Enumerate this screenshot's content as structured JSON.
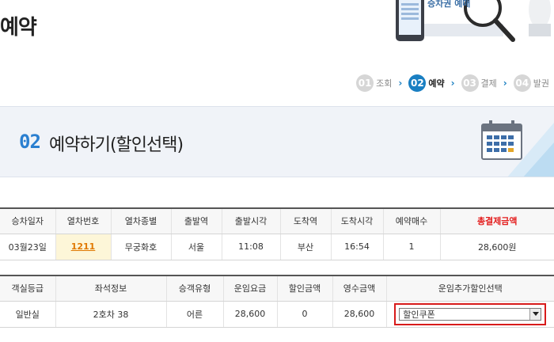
{
  "page": {
    "title": "예약"
  },
  "hero": {
    "caption": "승차권 예매"
  },
  "steps": [
    {
      "num": "01",
      "label": "조회"
    },
    {
      "num": "02",
      "label": "예약"
    },
    {
      "num": "03",
      "label": "결제"
    },
    {
      "num": "04",
      "label": "발권"
    }
  ],
  "banner": {
    "num": "02",
    "title": "예약하기(할인선택)"
  },
  "trip_table": {
    "headers": [
      "승차일자",
      "열차번호",
      "열차종별",
      "출발역",
      "출발시각",
      "도착역",
      "도착시각",
      "예약매수",
      "총결제금액"
    ],
    "row": {
      "date": "03월23일",
      "train_no": "1211",
      "train_type": "무궁화호",
      "departure_station": "서울",
      "departure_time": "11:08",
      "arrival_station": "부산",
      "arrival_time": "16:54",
      "tickets": "1",
      "total": "28,600원"
    }
  },
  "seat_table": {
    "headers": [
      "객실등급",
      "좌석정보",
      "승객유형",
      "운임요금",
      "할인금액",
      "영수금액",
      "운임추가할인선택"
    ],
    "row": {
      "class": "일반실",
      "seat": "2호차 38",
      "passenger": "어른",
      "fare": "28,600",
      "discount": "0",
      "receipt": "28,600",
      "discount_select": "할인쿠폰"
    }
  },
  "colors": {
    "accent": "#1a7fc2",
    "total": "#e31b1b",
    "train_link": "#e07800",
    "highlight_border": "#d81b1b"
  }
}
